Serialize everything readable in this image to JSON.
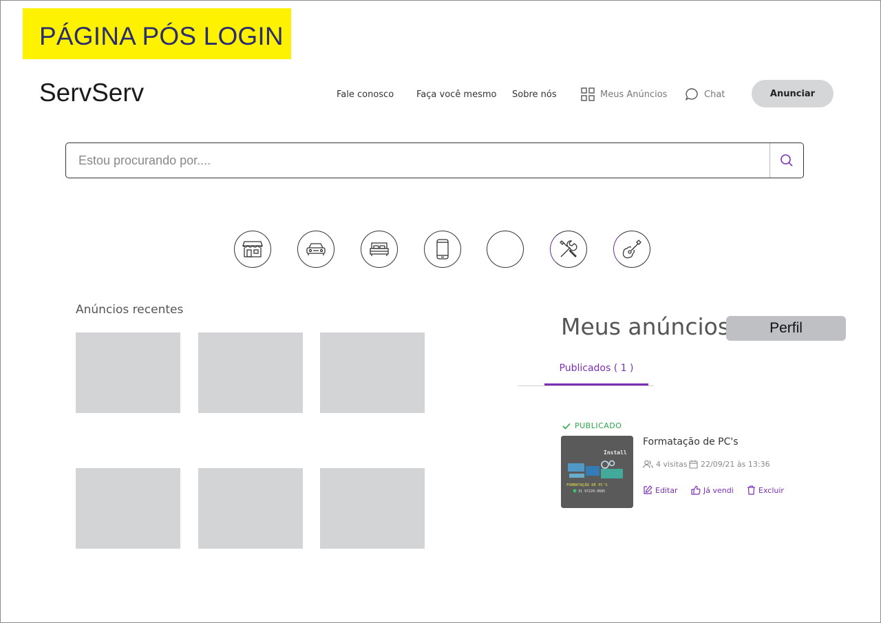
{
  "banner": {
    "label": "PÁGINA PÓS LOGIN"
  },
  "header": {
    "logo": "ServServ",
    "nav": {
      "contact": "Fale conosco",
      "diy": "Faça você mesmo",
      "about": "Sobre nós",
      "my_ads": "Meus Anúncios",
      "chat": "Chat"
    },
    "cta_label": "Anunciar"
  },
  "search": {
    "placeholder": "Estou procurando por...."
  },
  "categories": [
    {
      "icon": "store-icon"
    },
    {
      "icon": "car-icon"
    },
    {
      "icon": "bed-icon"
    },
    {
      "icon": "smartphone-icon"
    },
    {
      "icon": "empty"
    },
    {
      "icon": "tools-icon"
    },
    {
      "icon": "guitar-icon"
    }
  ],
  "recent": {
    "title": "Anúncios recentes"
  },
  "my_ads": {
    "title": "Meus anúncios",
    "profile_button": "Perfil",
    "tab_label": "Publicados ( 1 )",
    "item": {
      "status": "PUBLICADO",
      "title": "Formatação de PC's",
      "visits": "4 visitas",
      "date": "22/09/21 às 13:36",
      "image_text": {
        "top": "Install",
        "caption": "FORMATAÇÃO DE PC'S",
        "phone": "31 97220.9685"
      },
      "actions": {
        "edit": "Editar",
        "sold": "Já vendi",
        "delete": "Excluir"
      }
    }
  },
  "colors": {
    "banner": "#fff200",
    "accent": "#7b2fb5",
    "success": "#2aa64a",
    "placeholder_box": "#d3d4d6"
  }
}
